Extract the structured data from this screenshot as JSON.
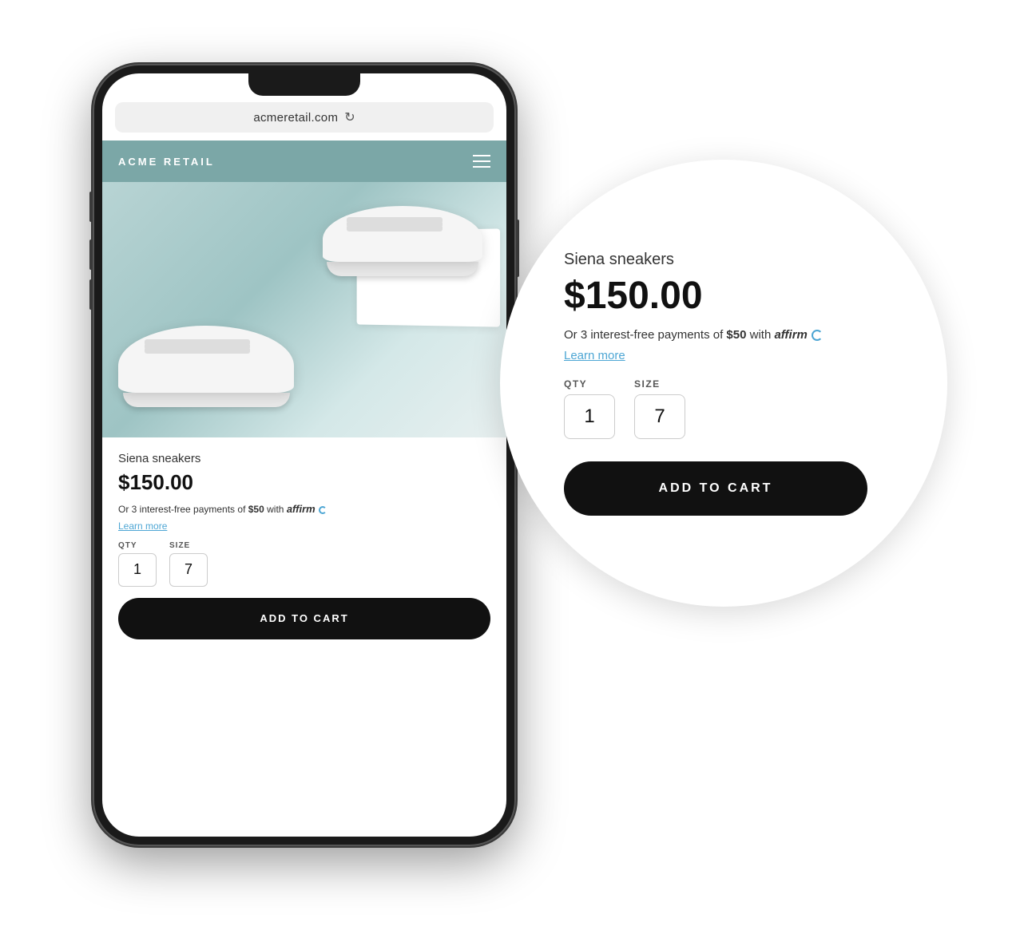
{
  "browser": {
    "url": "acmeretail.com",
    "refresh_icon": "↻"
  },
  "site": {
    "logo": "ACME RETAIL",
    "nav_icon": "hamburger"
  },
  "product": {
    "name": "Siena sneakers",
    "price": "$150.00",
    "affirm_text_prefix": "Or 3 interest-free payments of",
    "affirm_amount": "$50",
    "affirm_text_suffix": "with",
    "affirm_brand": "affirm",
    "learn_more": "Learn more",
    "qty_label": "QTY",
    "size_label": "SIZE",
    "qty_value": "1",
    "size_value": "7",
    "add_to_cart": "ADD TO CART"
  },
  "bubble": {
    "product_name": "Siena sneakers",
    "price": "$150.00",
    "affirm_text_prefix": "Or 3 interest-free payments of",
    "affirm_amount": "$50",
    "affirm_text_suffix": "with",
    "affirm_brand": "affirm",
    "learn_more": "Learn more",
    "qty_label": "QTY",
    "size_label": "SIZE",
    "qty_value": "1",
    "size_value": "7",
    "add_to_cart": "ADD TO CART"
  }
}
